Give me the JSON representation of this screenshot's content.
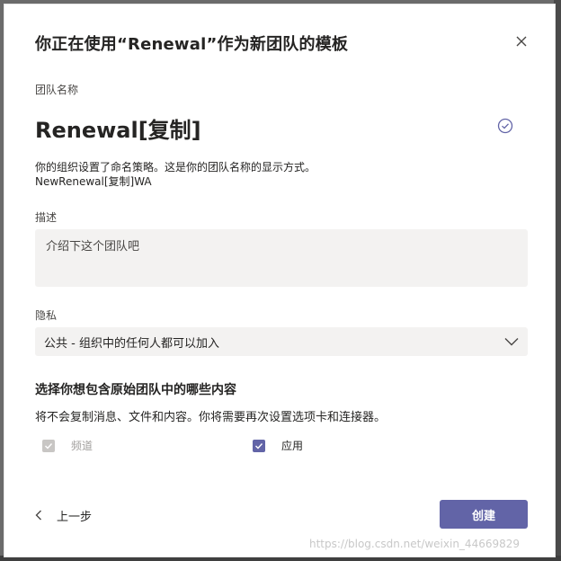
{
  "dialog": {
    "title": "你正在使用“Renewal”作为新团队的模板",
    "team_name_label": "团队名称",
    "team_name_value": "Renewal[复制]",
    "policy_line1": "你的组织设置了命名策略。这是你的团队名称的显示方式。",
    "policy_line2": "NewRenewal[复制]WA",
    "description_label": "描述",
    "description_placeholder": "介绍下这个团队吧",
    "privacy_label": "隐私",
    "privacy_value": "公共 - 组织中的任何人都可以加入",
    "include_title": "选择你想包含原始团队中的哪些内容",
    "include_subtitle": "将不会复制消息、文件和内容。你将需要再次设置选项卡和连接器。",
    "options": [
      {
        "label": "频道",
        "checked": true,
        "disabled": true
      },
      {
        "label": "应用",
        "checked": true,
        "disabled": false
      }
    ],
    "back_label": "上一步",
    "create_label": "创建"
  },
  "watermark": "https://blog.csdn.net/weixin_44669829",
  "colors": {
    "accent": "#6264a7",
    "input_bg": "#f3f2f1",
    "text": "#252423"
  },
  "icons": {
    "close": "close-icon",
    "check": "check-circle-icon",
    "dropdown": "chevron-down-icon",
    "back": "chevron-left-icon"
  }
}
